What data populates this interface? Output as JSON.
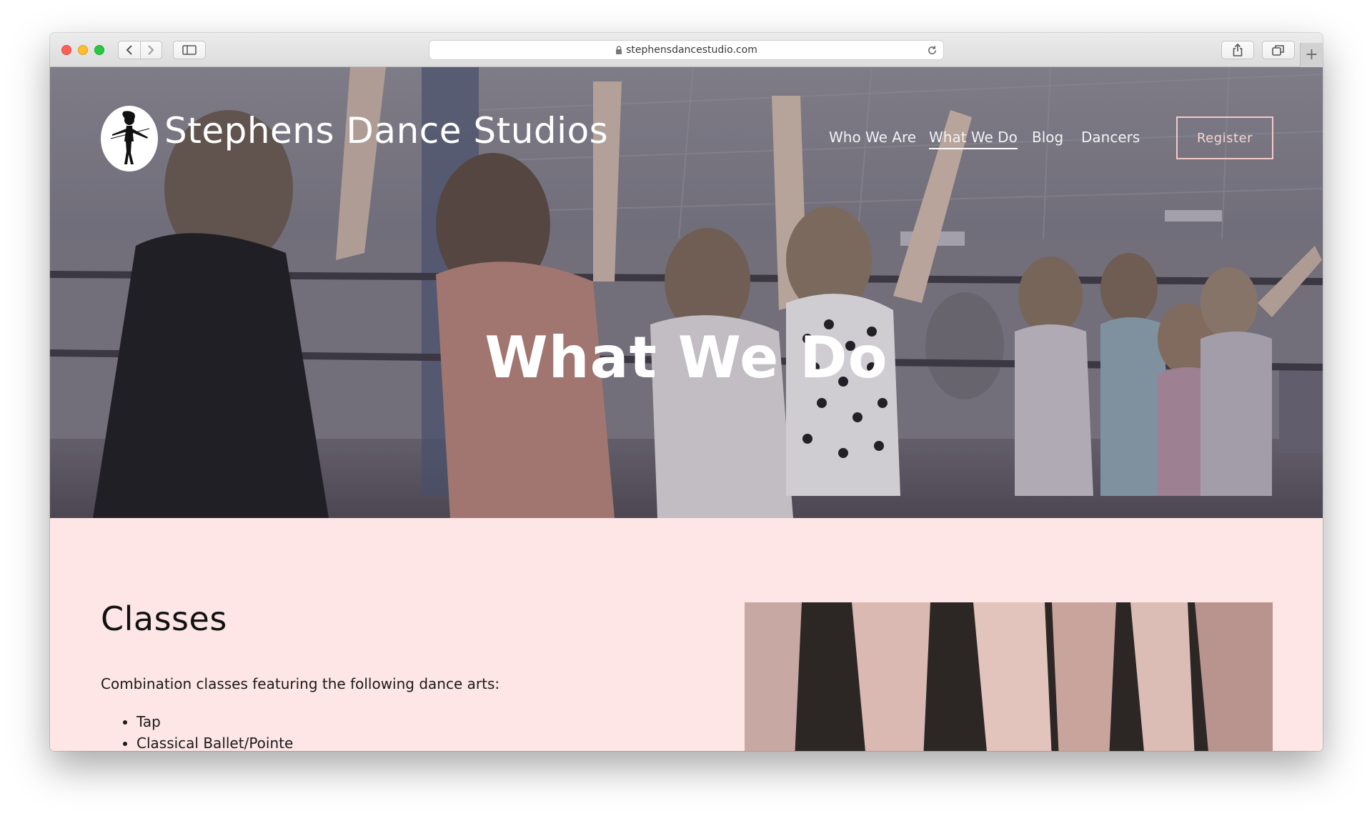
{
  "browser": {
    "url": "stephensdancestudio.com",
    "new_tab_label": "+"
  },
  "site": {
    "title": "Stephens Dance Studios",
    "nav": [
      {
        "label": "Who We Are",
        "active": false
      },
      {
        "label": "What We Do",
        "active": true
      },
      {
        "label": "Blog",
        "active": false
      },
      {
        "label": "Dancers",
        "active": false
      }
    ],
    "register_label": "Register"
  },
  "hero": {
    "heading": "What We Do"
  },
  "classes": {
    "title": "Classes",
    "intro": "Combination classes featuring the following dance arts:",
    "items": [
      "Tap",
      "Classical Ballet/Pointe"
    ]
  },
  "colors": {
    "content_bg": "#fde6e5",
    "register_border": "#f3c9c9",
    "hero_tint": "#6f6c78"
  },
  "icons": {
    "back": "chevron-left-icon",
    "forward": "chevron-right-icon",
    "sidebar": "sidebar-icon",
    "lock": "lock-icon",
    "reload": "reload-icon",
    "share": "share-icon",
    "tabs": "tabs-icon",
    "logo": "dancer-silhouette-icon"
  }
}
